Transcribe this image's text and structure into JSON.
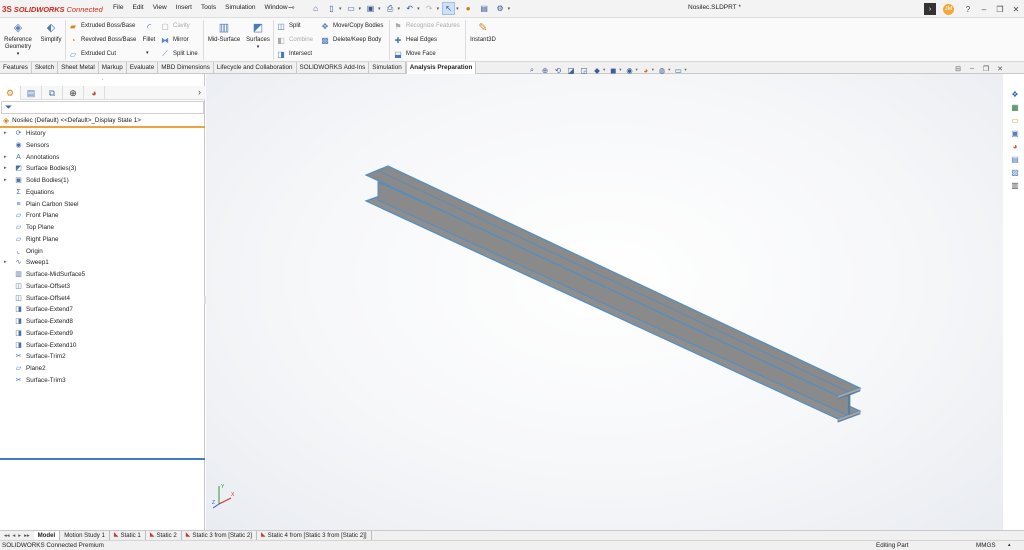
{
  "app": {
    "brand_ds": "3S",
    "brand_name": "SOLIDWORKS",
    "brand_suffix": "Connected",
    "document_title": "Nosilec.SLDPRT *"
  },
  "menu": [
    "File",
    "Edit",
    "View",
    "Insert",
    "Tools",
    "Simulation",
    "Window"
  ],
  "user_initials": "JM",
  "ribbon": {
    "reference_geometry": "Reference Geometry",
    "simplify": "Simplify",
    "extruded_boss": "Extruded Boss/Base",
    "revolved_boss": "Revolved Boss/Base",
    "extruded_cut": "Extruded Cut",
    "fillet": "Fillet",
    "cavity": "Cavity",
    "mirror": "Mirror",
    "split_line": "Split Line",
    "mid_surface": "Mid-Surface",
    "surfaces": "Surfaces",
    "split": "Split",
    "combine": "Combine",
    "intersect": "Intersect",
    "move_copy": "Move/Copy Bodies",
    "delete_keep": "Delete/Keep Body",
    "recognize_features": "Recognize Features",
    "heal_edges": "Heal Edges",
    "move_face": "Move Face",
    "instant3d": "Instant3D"
  },
  "command_tabs": [
    "Features",
    "Sketch",
    "Sheet Metal",
    "Markup",
    "Evaluate",
    "MBD Dimensions",
    "Lifecycle and Collaboration",
    "SOLIDWORKS Add-Ins",
    "Simulation",
    "Analysis Preparation"
  ],
  "active_command_tab": "Analysis Preparation",
  "feature_manager": {
    "root": "Nosilec (Default) <<Default>_Display State 1>",
    "items": [
      {
        "label": "History",
        "icon": "history-icon",
        "expandable": true
      },
      {
        "label": "Sensors",
        "icon": "sensors-icon",
        "expandable": false
      },
      {
        "label": "Annotations",
        "icon": "annotations-icon",
        "expandable": true
      },
      {
        "label": "Surface Bodies(3)",
        "icon": "surface-bodies-icon",
        "expandable": true
      },
      {
        "label": "Solid Bodies(1)",
        "icon": "solid-bodies-icon",
        "expandable": true
      },
      {
        "label": "Equations",
        "icon": "equations-icon",
        "expandable": false
      },
      {
        "label": "Plain Carbon Steel",
        "icon": "material-icon",
        "expandable": false
      },
      {
        "label": "Front Plane",
        "icon": "plane-icon",
        "expandable": false
      },
      {
        "label": "Top Plane",
        "icon": "plane-icon",
        "expandable": false
      },
      {
        "label": "Right Plane",
        "icon": "plane-icon",
        "expandable": false
      },
      {
        "label": "Origin",
        "icon": "origin-icon",
        "expandable": false
      },
      {
        "label": "Sweep1",
        "icon": "sweep-icon",
        "expandable": true
      },
      {
        "label": "Surface-MidSurface5",
        "icon": "midsurface-icon",
        "expandable": false
      },
      {
        "label": "Surface-Offset3",
        "icon": "offset-surface-icon",
        "expandable": false
      },
      {
        "label": "Surface-Offset4",
        "icon": "offset-surface-icon",
        "expandable": false
      },
      {
        "label": "Surface-Extend7",
        "icon": "extend-surface-icon",
        "expandable": false
      },
      {
        "label": "Surface-Extend8",
        "icon": "extend-surface-icon",
        "expandable": false
      },
      {
        "label": "Surface-Extend9",
        "icon": "extend-surface-icon",
        "expandable": false
      },
      {
        "label": "Surface-Extend10",
        "icon": "extend-surface-icon",
        "expandable": false
      },
      {
        "label": "Surface-Trim2",
        "icon": "trim-surface-icon",
        "expandable": false
      },
      {
        "label": "Plane2",
        "icon": "plane-icon",
        "expandable": false
      },
      {
        "label": "Surface-Trim3",
        "icon": "trim-surface-icon",
        "expandable": false
      }
    ]
  },
  "model_tabs": [
    {
      "label": "Model",
      "active": true,
      "study": false
    },
    {
      "label": "Motion Study 1",
      "active": false,
      "study": false
    },
    {
      "label": "Static 1",
      "active": false,
      "study": true
    },
    {
      "label": "Static 2",
      "active": false,
      "study": true
    },
    {
      "label": "Static 3 from [Static 2]",
      "active": false,
      "study": true
    },
    {
      "label": "Static 4 from [Static 3 from [Static 2]]",
      "active": false,
      "study": true
    }
  ],
  "status": {
    "product": "SOLIDWORKS Connected Premium",
    "mode": "Editing Part",
    "units": "MMGS"
  },
  "triad": {
    "x": "X",
    "y": "Y",
    "z": "Z"
  },
  "colors": {
    "accent": "#f2a23b",
    "brand": "#d52b1e",
    "beam_edge": "#4f8fc6",
    "beam_face": "#8e8e8e"
  }
}
